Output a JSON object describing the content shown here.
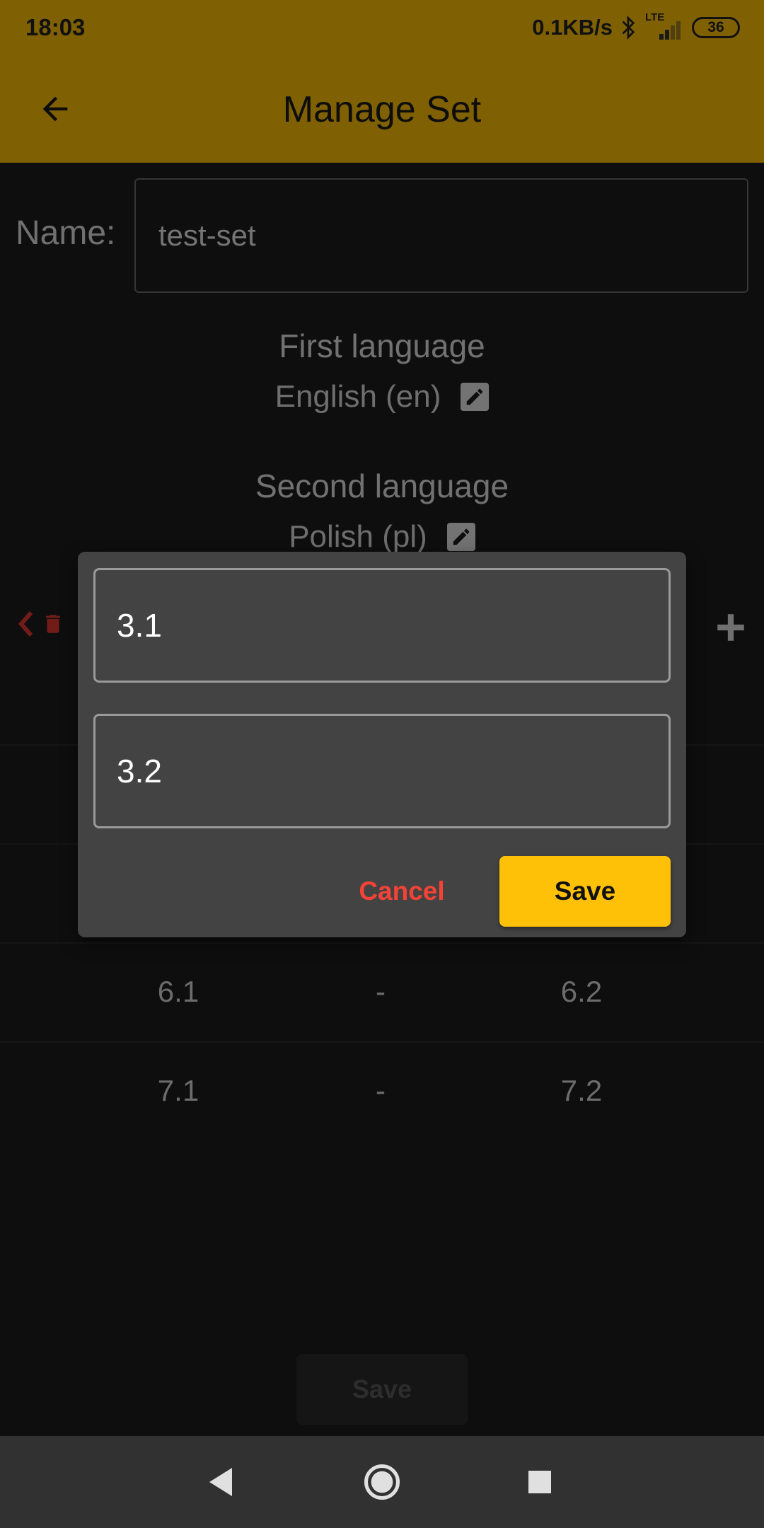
{
  "status_bar": {
    "time": "18:03",
    "network_speed": "0.1KB/s",
    "network_type": "LTE",
    "battery": "36"
  },
  "app_bar": {
    "title": "Manage Set"
  },
  "form": {
    "name_label": "Name:",
    "name_value": "test-set",
    "first_language_label": "First language",
    "first_language_value": "English (en)",
    "second_language_label": "Second language",
    "second_language_value": "Polish (pl)"
  },
  "pairs": [
    {
      "first": "6.1",
      "separator": "-",
      "second": "6.2"
    },
    {
      "first": "7.1",
      "separator": "-",
      "second": "7.2"
    }
  ],
  "bottom": {
    "save_label": "Save"
  },
  "dialog": {
    "first_value": "3.1",
    "second_value": "3.2",
    "cancel_label": "Cancel",
    "save_label": "Save"
  },
  "colors": {
    "accent": "#ffc107",
    "danger": "#f44336",
    "background": "#1c1c1c",
    "dialog": "#434343"
  }
}
